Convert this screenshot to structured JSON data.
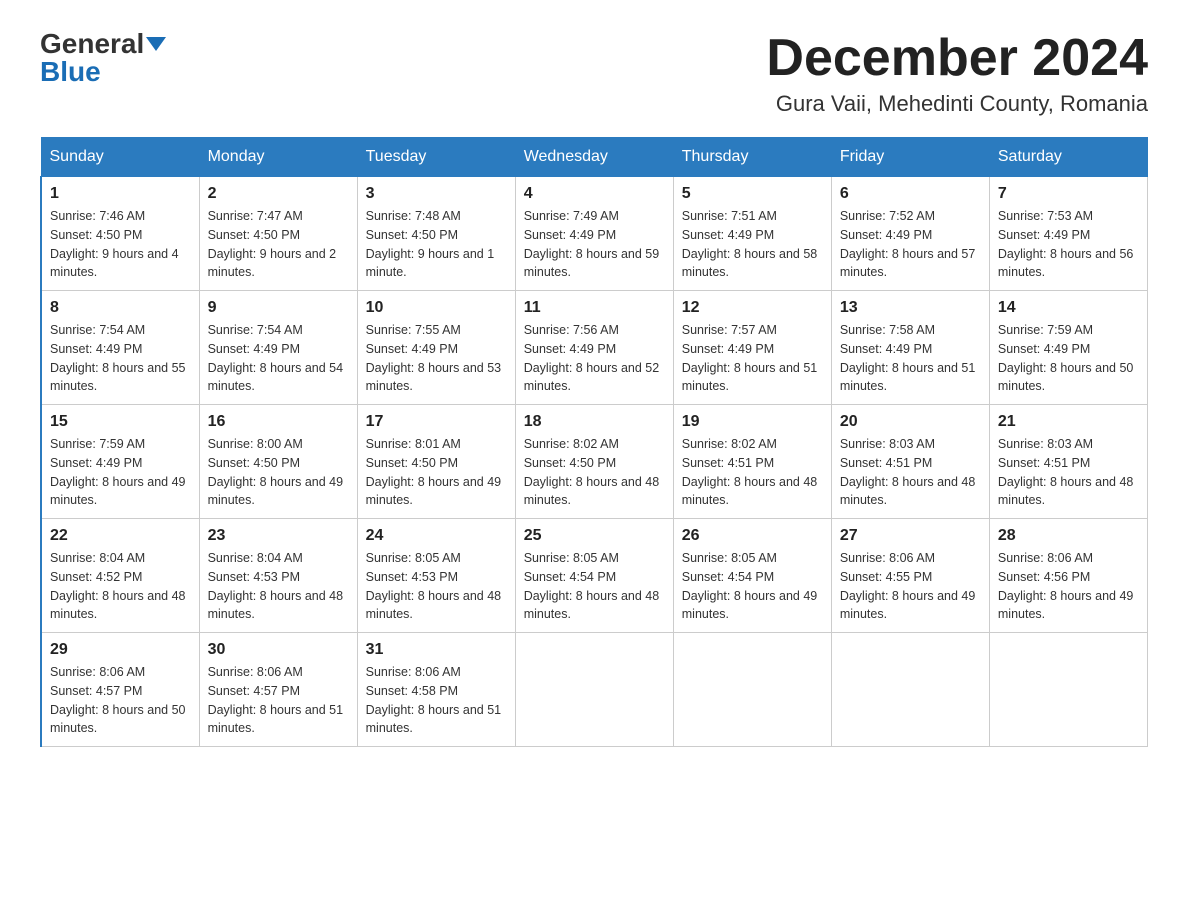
{
  "header": {
    "logo_general": "General",
    "logo_blue": "Blue",
    "month_year": "December 2024",
    "location": "Gura Vaii, Mehedinti County, Romania"
  },
  "days_of_week": [
    "Sunday",
    "Monday",
    "Tuesday",
    "Wednesday",
    "Thursday",
    "Friday",
    "Saturday"
  ],
  "weeks": [
    [
      {
        "day": "1",
        "sunrise": "7:46 AM",
        "sunset": "4:50 PM",
        "daylight": "9 hours and 4 minutes."
      },
      {
        "day": "2",
        "sunrise": "7:47 AM",
        "sunset": "4:50 PM",
        "daylight": "9 hours and 2 minutes."
      },
      {
        "day": "3",
        "sunrise": "7:48 AM",
        "sunset": "4:50 PM",
        "daylight": "9 hours and 1 minute."
      },
      {
        "day": "4",
        "sunrise": "7:49 AM",
        "sunset": "4:49 PM",
        "daylight": "8 hours and 59 minutes."
      },
      {
        "day": "5",
        "sunrise": "7:51 AM",
        "sunset": "4:49 PM",
        "daylight": "8 hours and 58 minutes."
      },
      {
        "day": "6",
        "sunrise": "7:52 AM",
        "sunset": "4:49 PM",
        "daylight": "8 hours and 57 minutes."
      },
      {
        "day": "7",
        "sunrise": "7:53 AM",
        "sunset": "4:49 PM",
        "daylight": "8 hours and 56 minutes."
      }
    ],
    [
      {
        "day": "8",
        "sunrise": "7:54 AM",
        "sunset": "4:49 PM",
        "daylight": "8 hours and 55 minutes."
      },
      {
        "day": "9",
        "sunrise": "7:54 AM",
        "sunset": "4:49 PM",
        "daylight": "8 hours and 54 minutes."
      },
      {
        "day": "10",
        "sunrise": "7:55 AM",
        "sunset": "4:49 PM",
        "daylight": "8 hours and 53 minutes."
      },
      {
        "day": "11",
        "sunrise": "7:56 AM",
        "sunset": "4:49 PM",
        "daylight": "8 hours and 52 minutes."
      },
      {
        "day": "12",
        "sunrise": "7:57 AM",
        "sunset": "4:49 PM",
        "daylight": "8 hours and 51 minutes."
      },
      {
        "day": "13",
        "sunrise": "7:58 AM",
        "sunset": "4:49 PM",
        "daylight": "8 hours and 51 minutes."
      },
      {
        "day": "14",
        "sunrise": "7:59 AM",
        "sunset": "4:49 PM",
        "daylight": "8 hours and 50 minutes."
      }
    ],
    [
      {
        "day": "15",
        "sunrise": "7:59 AM",
        "sunset": "4:49 PM",
        "daylight": "8 hours and 49 minutes."
      },
      {
        "day": "16",
        "sunrise": "8:00 AM",
        "sunset": "4:50 PM",
        "daylight": "8 hours and 49 minutes."
      },
      {
        "day": "17",
        "sunrise": "8:01 AM",
        "sunset": "4:50 PM",
        "daylight": "8 hours and 49 minutes."
      },
      {
        "day": "18",
        "sunrise": "8:02 AM",
        "sunset": "4:50 PM",
        "daylight": "8 hours and 48 minutes."
      },
      {
        "day": "19",
        "sunrise": "8:02 AM",
        "sunset": "4:51 PM",
        "daylight": "8 hours and 48 minutes."
      },
      {
        "day": "20",
        "sunrise": "8:03 AM",
        "sunset": "4:51 PM",
        "daylight": "8 hours and 48 minutes."
      },
      {
        "day": "21",
        "sunrise": "8:03 AM",
        "sunset": "4:51 PM",
        "daylight": "8 hours and 48 minutes."
      }
    ],
    [
      {
        "day": "22",
        "sunrise": "8:04 AM",
        "sunset": "4:52 PM",
        "daylight": "8 hours and 48 minutes."
      },
      {
        "day": "23",
        "sunrise": "8:04 AM",
        "sunset": "4:53 PM",
        "daylight": "8 hours and 48 minutes."
      },
      {
        "day": "24",
        "sunrise": "8:05 AM",
        "sunset": "4:53 PM",
        "daylight": "8 hours and 48 minutes."
      },
      {
        "day": "25",
        "sunrise": "8:05 AM",
        "sunset": "4:54 PM",
        "daylight": "8 hours and 48 minutes."
      },
      {
        "day": "26",
        "sunrise": "8:05 AM",
        "sunset": "4:54 PM",
        "daylight": "8 hours and 49 minutes."
      },
      {
        "day": "27",
        "sunrise": "8:06 AM",
        "sunset": "4:55 PM",
        "daylight": "8 hours and 49 minutes."
      },
      {
        "day": "28",
        "sunrise": "8:06 AM",
        "sunset": "4:56 PM",
        "daylight": "8 hours and 49 minutes."
      }
    ],
    [
      {
        "day": "29",
        "sunrise": "8:06 AM",
        "sunset": "4:57 PM",
        "daylight": "8 hours and 50 minutes."
      },
      {
        "day": "30",
        "sunrise": "8:06 AM",
        "sunset": "4:57 PM",
        "daylight": "8 hours and 51 minutes."
      },
      {
        "day": "31",
        "sunrise": "8:06 AM",
        "sunset": "4:58 PM",
        "daylight": "8 hours and 51 minutes."
      },
      null,
      null,
      null,
      null
    ]
  ]
}
